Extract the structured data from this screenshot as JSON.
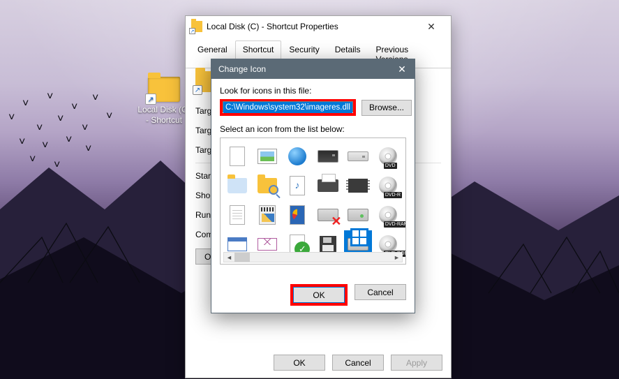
{
  "desktop": {
    "icon_label_line1": "Local Disk (C)",
    "icon_label_line2": "- Shortcut"
  },
  "properties": {
    "title": "Local Disk (C) - Shortcut Properties",
    "tabs": [
      "General",
      "Shortcut",
      "Security",
      "Details",
      "Previous Versions"
    ],
    "active_tab_index": 1,
    "fields": {
      "target_type": "Target type:",
      "target_location": "Target location:",
      "target": "Target:",
      "start_in": "Start in:",
      "shortcut_key": "Shortcut key:",
      "run": "Run:",
      "comment": "Comment:"
    },
    "inline_button": "Open File Location",
    "footer": {
      "ok": "OK",
      "cancel": "Cancel",
      "apply": "Apply"
    }
  },
  "change_icon": {
    "title": "Change Icon",
    "look_label": "Look for icons in this file:",
    "path_value": "C:\\Windows\\system32\\imageres.dll",
    "browse": "Browse...",
    "select_label": "Select an icon from the list below:",
    "icons": [
      {
        "name": "blank-sheet"
      },
      {
        "name": "photo"
      },
      {
        "name": "globe"
      },
      {
        "name": "floppy-drive"
      },
      {
        "name": "optical-drive"
      },
      {
        "name": "dvd-disc",
        "badge": "DVD"
      },
      {
        "name": "folder-open"
      },
      {
        "name": "folder-search"
      },
      {
        "name": "music-sheet"
      },
      {
        "name": "printer"
      },
      {
        "name": "ram-chip"
      },
      {
        "name": "dvd-r-disc",
        "badge": "DVD-R"
      },
      {
        "name": "text-sheet"
      },
      {
        "name": "video-file"
      },
      {
        "name": "chart-sheet"
      },
      {
        "name": "drive-error"
      },
      {
        "name": "drive-removable"
      },
      {
        "name": "dvd-ram-disc",
        "badge": "DVD-RAM"
      },
      {
        "name": "desktop-window"
      },
      {
        "name": "envelope"
      },
      {
        "name": "verified-sheet"
      },
      {
        "name": "floppy-disk"
      },
      {
        "name": "windows-drive"
      },
      {
        "name": "dvd-rom-disc",
        "badge": "DVD-ROM"
      }
    ],
    "selected_index": 22,
    "footer": {
      "ok": "OK",
      "cancel": "Cancel"
    }
  }
}
